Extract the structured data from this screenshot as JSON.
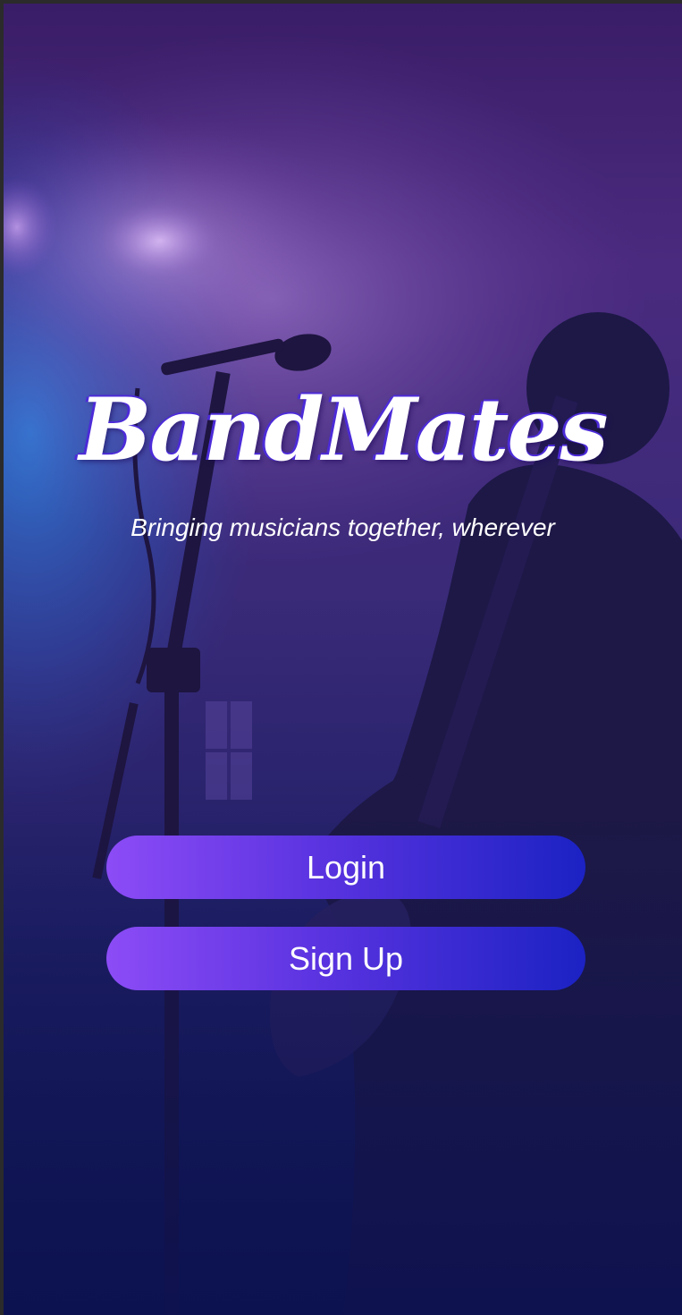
{
  "app": {
    "title": "BandMates",
    "tagline": "Bringing musicians together, wherever"
  },
  "actions": {
    "login_label": "Login",
    "signup_label": "Sign Up"
  },
  "colors": {
    "button_gradient_start": "#8c4cf6",
    "button_gradient_end": "#1b22c3",
    "title_outline": "#4c2bd8",
    "background_top": "#3a1d68",
    "background_bottom": "#0f1552"
  }
}
